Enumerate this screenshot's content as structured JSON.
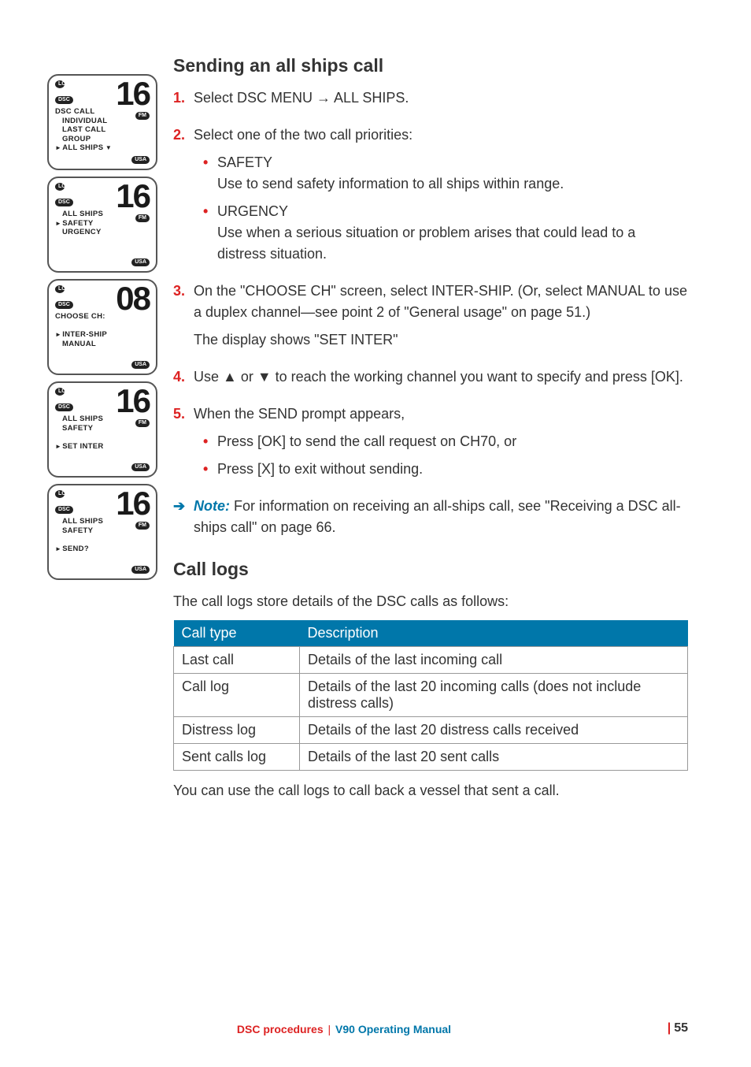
{
  "screens": [
    {
      "big": "16",
      "icons": {
        "lo": "LO",
        "dsc": "DSC",
        "fm": "FM",
        "usa": "USA"
      },
      "lines": [
        {
          "t": "DSC CALL"
        },
        {
          "t": "INDIVIDUAL",
          "cls": "indent"
        },
        {
          "t": "LAST CALL",
          "cls": "indent"
        },
        {
          "t": "GROUP",
          "cls": "indent"
        },
        {
          "t": "ALL SHIPS",
          "cls": "arrow downcaret"
        }
      ]
    },
    {
      "big": "16",
      "icons": {
        "lo": "LO",
        "dsc": "DSC",
        "fm": "FM",
        "usa": "USA"
      },
      "lines": [
        {
          "t": "ALL SHIPS",
          "cls": "indent"
        },
        {
          "t": "SAFETY",
          "cls": "arrow"
        },
        {
          "t": "URGENCY",
          "cls": "indent"
        }
      ]
    },
    {
      "big": "08",
      "icons": {
        "lo": "LO",
        "dsc": "DSC",
        "usa": "USA"
      },
      "lines": [
        {
          "t": "CHOOSE CH:"
        },
        {
          "t": ""
        },
        {
          "t": "INTER-SHIP",
          "cls": "arrow"
        },
        {
          "t": "MANUAL",
          "cls": "indent"
        }
      ]
    },
    {
      "big": "16",
      "icons": {
        "lo": "LO",
        "dsc": "DSC",
        "fm": "FM",
        "usa": "USA"
      },
      "lines": [
        {
          "t": "ALL SHIPS",
          "cls": "indent"
        },
        {
          "t": "SAFETY",
          "cls": "indent"
        },
        {
          "t": ""
        },
        {
          "t": "SET INTER",
          "cls": "arrow"
        }
      ]
    },
    {
      "big": "16",
      "icons": {
        "lo": "LO",
        "dsc": "DSC",
        "fm": "FM",
        "usa": "USA"
      },
      "lines": [
        {
          "t": "ALL SHIPS",
          "cls": "indent"
        },
        {
          "t": "SAFETY",
          "cls": "indent"
        },
        {
          "t": ""
        },
        {
          "t": "SEND?",
          "cls": "arrow"
        }
      ]
    }
  ],
  "h1": "Sending an all ships call",
  "steps": [
    {
      "n": "1.",
      "body": [
        {
          "type": "p",
          "text": "Select DSC MENU → ALL SHIPS."
        }
      ]
    },
    {
      "n": "2.",
      "body": [
        {
          "type": "p",
          "text": "Select one of the two call priorities:"
        },
        {
          "type": "ul",
          "items": [
            {
              "lead": "SAFETY",
              "text": "Use to send safety information to all ships within range."
            },
            {
              "lead": "URGENCY",
              "text": "Use when a serious situation or problem arises that could lead to a distress situation."
            }
          ]
        }
      ]
    },
    {
      "n": "3.",
      "body": [
        {
          "type": "p",
          "text": "On the \"CHOOSE CH\" screen, select INTER-SHIP.  (Or, select MANUAL to use a duplex channel—see point 2 of \"General usage\" on page 51.)"
        },
        {
          "type": "p",
          "text": "The display shows \"SET INTER\""
        }
      ]
    },
    {
      "n": "4.",
      "body": [
        {
          "type": "p",
          "text": "Use ▲ or ▼ to reach the working channel you want to specify and press [OK]."
        }
      ]
    },
    {
      "n": "5.",
      "body": [
        {
          "type": "p",
          "text": "When the SEND prompt appears,"
        },
        {
          "type": "ul",
          "items": [
            {
              "text": "Press [OK] to send the call request on CH70, or"
            },
            {
              "text": "Press [X] to exit without sending."
            }
          ]
        }
      ]
    }
  ],
  "note": {
    "label": "Note:",
    "text": " For information on receiving an all-ships call, see \"Receiving a DSC all-ships call\" on page 66."
  },
  "h2": "Call logs",
  "intro": "The call logs store details of the DSC calls as follows:",
  "table": {
    "headers": [
      "Call type",
      "Description"
    ],
    "rows": [
      [
        "Last call",
        "Details of the last incoming call"
      ],
      [
        "Call log",
        "Details of the last 20 incoming calls (does not include distress calls)"
      ],
      [
        "Distress log",
        "Details of the last 20 distress calls received"
      ],
      [
        "Sent calls log",
        "Details of the last 20 sent calls"
      ]
    ]
  },
  "outro": "You can use the call logs to call back a vessel that sent a call.",
  "footer": {
    "section": "DSC procedures",
    "manual": "V90 Operating Manual",
    "page": "55"
  }
}
